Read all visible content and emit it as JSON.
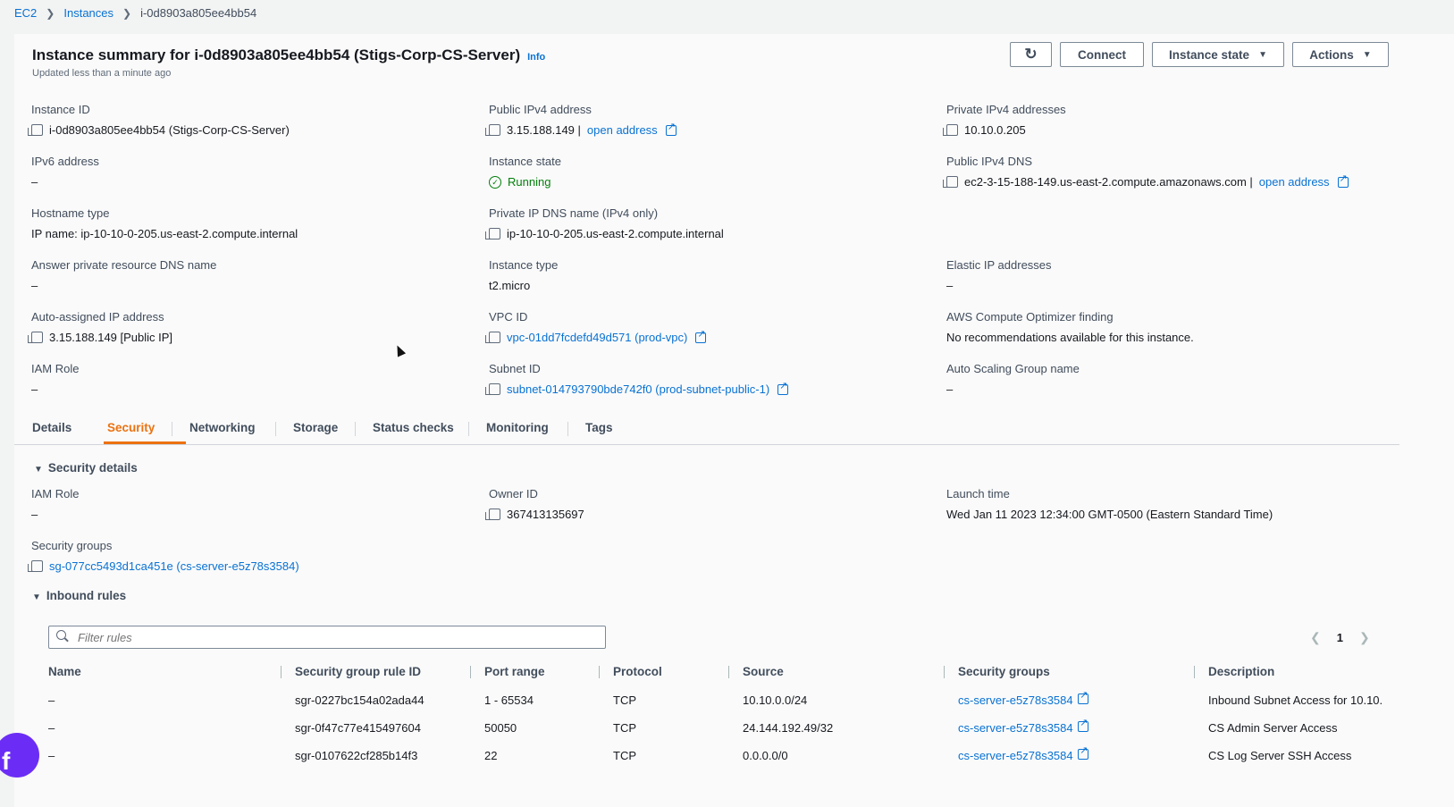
{
  "breadcrumb": {
    "root": "EC2",
    "instances": "Instances",
    "current": "i-0d8903a805ee4bb54"
  },
  "header": {
    "title": "Instance summary for i-0d8903a805ee4bb54 (Stigs-Corp-CS-Server)",
    "info": "Info",
    "updated": "Updated less than a minute ago",
    "connect": "Connect",
    "instance_state": "Instance state",
    "actions": "Actions"
  },
  "summary": {
    "instance_id": {
      "label": "Instance ID",
      "value": "i-0d8903a805ee4bb54 (Stigs-Corp-CS-Server)"
    },
    "public_ipv4": {
      "label": "Public IPv4 address",
      "value": "3.15.188.149 |",
      "link": "open address"
    },
    "private_ipv4": {
      "label": "Private IPv4 addresses",
      "value": "10.10.0.205"
    },
    "ipv6": {
      "label": "IPv6 address",
      "value": "–"
    },
    "instance_state": {
      "label": "Instance state",
      "value": "Running"
    },
    "public_dns": {
      "label": "Public IPv4 DNS",
      "value": "ec2-3-15-188-149.us-east-2.compute.amazonaws.com |",
      "link": "open address"
    },
    "hostname_type": {
      "label": "Hostname type",
      "value": "IP name: ip-10-10-0-205.us-east-2.compute.internal"
    },
    "private_dns": {
      "label": "Private IP DNS name (IPv4 only)",
      "value": "ip-10-10-0-205.us-east-2.compute.internal"
    },
    "answer_dns": {
      "label": "Answer private resource DNS name",
      "value": "–"
    },
    "instance_type": {
      "label": "Instance type",
      "value": "t2.micro"
    },
    "elastic_ip": {
      "label": "Elastic IP addresses",
      "value": "–"
    },
    "auto_ip": {
      "label": "Auto-assigned IP address",
      "value": "3.15.188.149 [Public IP]"
    },
    "vpc_id": {
      "label": "VPC ID",
      "value": "vpc-01dd7fcdefd49d571 (prod-vpc)"
    },
    "optimizer": {
      "label": "AWS Compute Optimizer finding",
      "value": "No recommendations available for this instance."
    },
    "iam_role": {
      "label": "IAM Role",
      "value": "–"
    },
    "subnet_id": {
      "label": "Subnet ID",
      "value": "subnet-014793790bde742f0 (prod-subnet-public-1)"
    },
    "asg_name": {
      "label": "Auto Scaling Group name",
      "value": "–"
    }
  },
  "tabs": [
    "Details",
    "Security",
    "Networking",
    "Storage",
    "Status checks",
    "Monitoring",
    "Tags"
  ],
  "security": {
    "heading": "Security details",
    "iam_role": {
      "label": "IAM Role",
      "value": "–"
    },
    "owner_id": {
      "label": "Owner ID",
      "value": "367413135697"
    },
    "launch_time": {
      "label": "Launch time",
      "value": "Wed Jan 11 2023 12:34:00 GMT-0500 (Eastern Standard Time)"
    },
    "security_groups": {
      "label": "Security groups",
      "value": "sg-077cc5493d1ca451e (cs-server-e5z78s3584)"
    }
  },
  "inbound": {
    "heading": "Inbound rules",
    "filter_placeholder": "Filter rules",
    "page": "1",
    "columns": [
      "Name",
      "Security group rule ID",
      "Port range",
      "Protocol",
      "Source",
      "Security groups",
      "Description"
    ],
    "rows": [
      {
        "name": "–",
        "rule_id": "sgr-0227bc154a02ada44",
        "port": "1 - 65534",
        "protocol": "TCP",
        "source": "10.10.0.0/24",
        "sg": "cs-server-e5z78s3584",
        "description": "Inbound Subnet Access for 10.10."
      },
      {
        "name": "–",
        "rule_id": "sgr-0f47c77e415497604",
        "port": "50050",
        "protocol": "TCP",
        "source": "24.144.192.49/32",
        "sg": "cs-server-e5z78s3584",
        "description": "CS Admin Server Access"
      },
      {
        "name": "–",
        "rule_id": "sgr-0107622cf285b14f3",
        "port": "22",
        "protocol": "TCP",
        "source": "0.0.0.0/0",
        "sg": "cs-server-e5z78s3584",
        "description": "CS Log Server SSH Access"
      }
    ]
  },
  "badge": {
    "letter": "f",
    "color": "#6b2df5"
  },
  "colors": {
    "link": "#0972d3",
    "active_tab": "#ec7211",
    "running": "#037f0c"
  }
}
